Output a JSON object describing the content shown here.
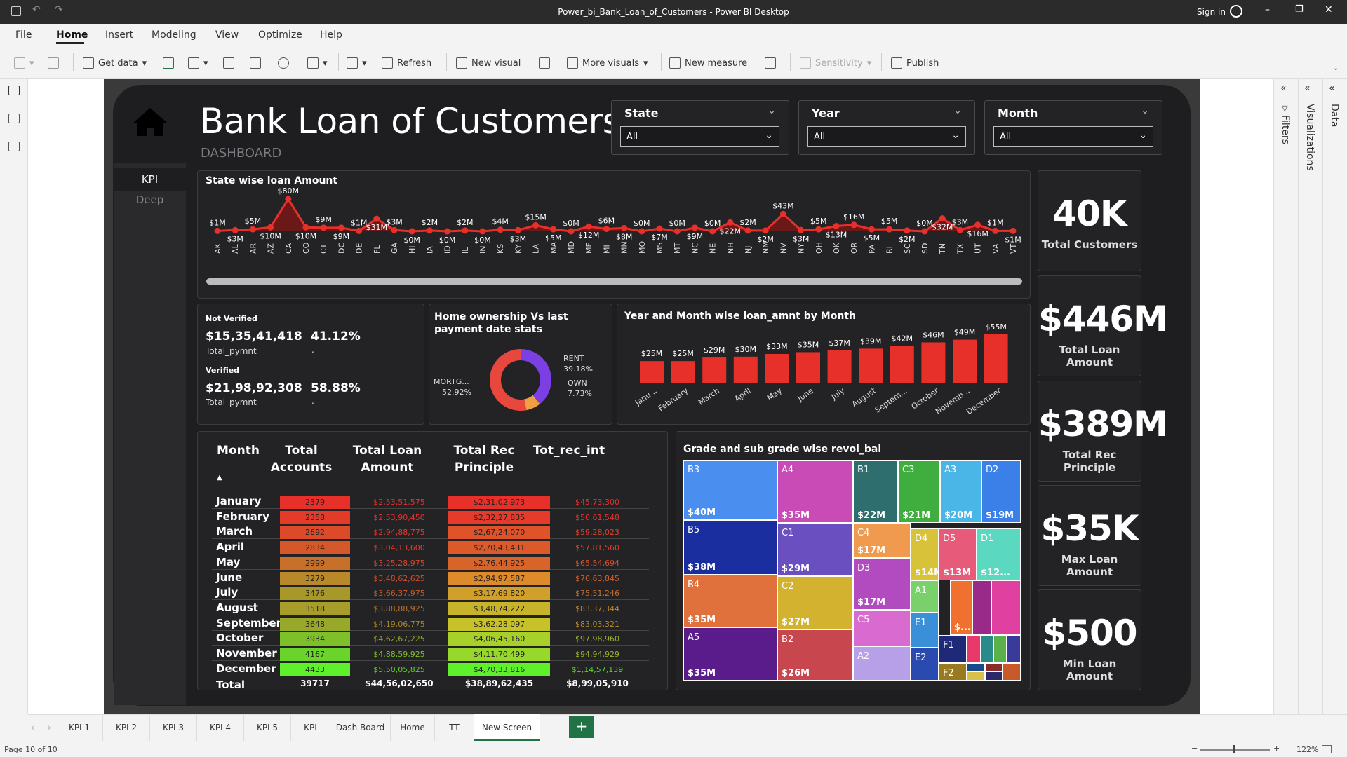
{
  "window": {
    "title": "Power_bi_Bank_Loan_of_Customers - Power BI Desktop",
    "sign_in": "Sign in"
  },
  "menu": [
    "File",
    "Home",
    "Insert",
    "Modeling",
    "View",
    "Optimize",
    "Help"
  ],
  "ribbon": {
    "get_data": "Get data",
    "refresh": "Refresh",
    "new_visual": "New visual",
    "more_visuals": "More visuals",
    "new_measure": "New measure",
    "sensitivity": "Sensitivity",
    "publish": "Publish"
  },
  "panes": {
    "filters": "Filters",
    "visualizations": "Visualizations",
    "data": "Data"
  },
  "report": {
    "title": "Bank Loan of Customers",
    "subtitle": "DASHBOARD",
    "nav": [
      "KPI",
      "Deep"
    ],
    "slicers": [
      {
        "label": "State",
        "value": "All"
      },
      {
        "label": "Year",
        "value": "All"
      },
      {
        "label": "Month",
        "value": "All"
      }
    ],
    "kpis": [
      {
        "value": "40K",
        "label": "Total Customers"
      },
      {
        "value": "$446M",
        "label": "Total Loan Amount"
      },
      {
        "value": "$389M",
        "label": "Total Rec Principle"
      },
      {
        "value": "$35K",
        "label": "Max Loan Amount"
      },
      {
        "value": "$500",
        "label": "Min Loan Amount"
      }
    ],
    "verification": {
      "not_verified_label": "Not Verified",
      "not_verified_amount": "$15,35,41,418",
      "not_verified_pct": "41.12%",
      "verified_label": "Verified",
      "verified_amount": "$21,98,92,308",
      "verified_pct": "58.88%",
      "sub_label": "Total_pymnt",
      "dot": "."
    },
    "state_chart": {
      "title": "State wise loan Amount",
      "states": [
        "AK",
        "AL",
        "AR",
        "AZ",
        "CA",
        "CO",
        "CT",
        "DC",
        "DE",
        "FL",
        "GA",
        "HI",
        "IA",
        "ID",
        "IL",
        "IN",
        "KS",
        "KY",
        "LA",
        "MA",
        "MD",
        "ME",
        "MI",
        "MN",
        "MO",
        "MS",
        "MT",
        "NC",
        "NE",
        "NH",
        "NJ",
        "NM",
        "NV",
        "NY",
        "OH",
        "OK",
        "OR",
        "PA",
        "RI",
        "SC",
        "SD",
        "TN",
        "TX",
        "UT",
        "VA",
        "VT"
      ],
      "labels": [
        "$1M",
        "$3M",
        "$5M",
        "$10M",
        "$80M",
        "$10M",
        "$9M",
        "$9M",
        "$1M",
        "$31M",
        "$3M",
        "$0M",
        "$2M",
        "$0M",
        "$2M",
        "$0M",
        "$4M",
        "$3M",
        "$15M",
        "$5M",
        "$0M",
        "$12M",
        "$6M",
        "$8M",
        "$0M",
        "$7M",
        "$0M",
        "$9M",
        "$0M",
        "$22M",
        "$2M",
        "$2M",
        "$43M",
        "$3M",
        "$5M",
        "$13M",
        "$16M",
        "$5M",
        "$5M",
        "$2M",
        "$0M",
        "$32M",
        "$3M",
        "$16M",
        "$1M",
        "$1M"
      ]
    },
    "donut": {
      "title": "Home ownership Vs last payment date stats",
      "slices": [
        {
          "name": "MORTG...",
          "pct": "52.92%",
          "value": 52.92,
          "color": "#e8473e"
        },
        {
          "name": "RENT",
          "pct": "39.18%",
          "value": 39.18,
          "color": "#7b3fe4"
        },
        {
          "name": "OWN",
          "pct": "7.73%",
          "value": 7.73,
          "color": "#f0a040"
        }
      ]
    },
    "month_chart": {
      "title": "Year and Month wise loan_amnt by Month",
      "labels": [
        "$25M",
        "$25M",
        "$29M",
        "$30M",
        "$33M",
        "$35M",
        "$37M",
        "$39M",
        "$42M",
        "$46M",
        "$49M",
        "$55M"
      ],
      "values": [
        25,
        25,
        29,
        30,
        33,
        35,
        37,
        39,
        42,
        46,
        49,
        55
      ],
      "categories": [
        "Janu...",
        "February",
        "March",
        "April",
        "May",
        "June",
        "July",
        "August",
        "Septem...",
        "October",
        "Novemb...",
        "December"
      ]
    },
    "table": {
      "headers": [
        "Month",
        "Total Accounts",
        "Total Loan Amount",
        "Total Rec Principle",
        "Tot_rec_int"
      ],
      "rows": [
        [
          "January",
          "2379",
          "$2,53,51,575",
          "$2,31,02,973",
          "$45,73,300"
        ],
        [
          "February",
          "2358",
          "$2,53,90,450",
          "$2,32,27,835",
          "$50,61,548"
        ],
        [
          "March",
          "2692",
          "$2,94,88,775",
          "$2,67,24,070",
          "$59,28,023"
        ],
        [
          "April",
          "2834",
          "$3,04,13,600",
          "$2,70,43,431",
          "$57,81,560"
        ],
        [
          "May",
          "2999",
          "$3,25,28,975",
          "$2,76,44,925",
          "$65,54,694"
        ],
        [
          "June",
          "3279",
          "$3,48,62,625",
          "$2,94,97,587",
          "$70,63,845"
        ],
        [
          "July",
          "3476",
          "$3,66,37,975",
          "$3,17,69,820",
          "$75,51,246"
        ],
        [
          "August",
          "3518",
          "$3,88,88,925",
          "$3,48,74,222",
          "$83,37,344"
        ],
        [
          "September",
          "3648",
          "$4,19,06,775",
          "$3,62,28,097",
          "$83,03,321"
        ],
        [
          "October",
          "3934",
          "$4,62,67,225",
          "$4,06,45,160",
          "$97,98,960"
        ],
        [
          "November",
          "4167",
          "$4,88,59,925",
          "$4,11,70,499",
          "$94,94,929"
        ],
        [
          "December",
          "4433",
          "$5,50,05,825",
          "$4,70,33,816",
          "$1,14,57,139"
        ]
      ],
      "total": [
        "Total",
        "39717",
        "$44,56,02,650",
        "$38,89,62,435",
        "$8,99,05,910"
      ]
    },
    "treemap": {
      "title": "Grade and sub grade wise revol_bal",
      "tiles": [
        {
          "name": "B3",
          "value": "$40M",
          "color": "#4a8ef0"
        },
        {
          "name": "A4",
          "value": "$35M",
          "color": "#c94cb6"
        },
        {
          "name": "B1",
          "value": "$22M",
          "color": "#2f6e6e"
        },
        {
          "name": "C3",
          "value": "$21M",
          "color": "#3fae3f"
        },
        {
          "name": "A3",
          "value": "$20M",
          "color": "#4ab6e8"
        },
        {
          "name": "D2",
          "value": "$19M",
          "color": "#3b7fe8"
        },
        {
          "name": "B5",
          "value": "$38M",
          "color": "#1a2ea0"
        },
        {
          "name": "C1",
          "value": "$29M",
          "color": "#6a4fc0"
        },
        {
          "name": "C4",
          "value": "$17M",
          "color": "#f09a50"
        },
        {
          "name": "D4",
          "value": "$14M",
          "color": "#d8c23a"
        },
        {
          "name": "D5",
          "value": "$13M",
          "color": "#e85a7a"
        },
        {
          "name": "D1",
          "value": "$12...",
          "color": "#5ad8c0"
        },
        {
          "name": "B4",
          "value": "$35M",
          "color": "#e0703c"
        },
        {
          "name": "D3",
          "value": "$17M",
          "color": "#b24ac0"
        },
        {
          "name": "A1",
          "value": "",
          "color": "#7ad06a"
        },
        {
          "name": "C2",
          "value": "$27M",
          "color": "#d2b22e"
        },
        {
          "name": "C5",
          "value": "",
          "color": "#d86ad0"
        },
        {
          "name": "E1",
          "value": "",
          "color": "#3a90d8"
        },
        {
          "name": "",
          "value": "$...",
          "color": "#f07030"
        },
        {
          "name": "A5",
          "value": "$35M",
          "color": "#5a1c8a"
        },
        {
          "name": "B2",
          "value": "$26M",
          "color": "#c8464e"
        },
        {
          "name": "A2",
          "value": "",
          "color": "#b8a0e8"
        },
        {
          "name": "E2",
          "value": "",
          "color": "#2a4ab0"
        },
        {
          "name": "F1",
          "value": "",
          "color": "#1e2a78"
        },
        {
          "name": "F2",
          "value": "",
          "color": "#9a7a20"
        }
      ]
    }
  },
  "page_tabs": [
    "KPI 1",
    "KPI 2",
    "KPI 3",
    "KPI 4",
    "KPI 5",
    "KPI",
    "Dash Board",
    "Home",
    "TT",
    "New Screen"
  ],
  "active_tab": "New Screen",
  "status": {
    "page": "Page 10 of 10",
    "zoom": "122%"
  }
}
